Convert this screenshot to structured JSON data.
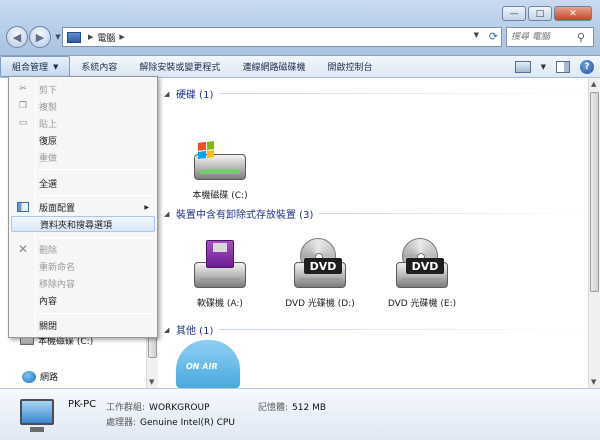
{
  "window": {
    "controls": [
      "—",
      "□",
      "✕"
    ]
  },
  "address": {
    "crumb": "電腦",
    "search_placeholder": "搜尋 電腦"
  },
  "toolbar": {
    "organize": "組合管理",
    "items": [
      "系統內容",
      "解除安裝或變更程式",
      "連線網路磁碟機",
      "開啟控制台"
    ]
  },
  "menu": {
    "cut": "剪下",
    "copy": "複製",
    "paste": "貼上",
    "undo": "復原",
    "redo": "重做",
    "select_all": "全選",
    "layout": "版面配置",
    "folder_options": "資料夾和搜尋選項",
    "delete": "刪除",
    "rename": "重新命名",
    "remove_properties": "移除內容",
    "properties": "內容",
    "close": "關閉"
  },
  "navpane": {
    "local_disk": "本機磁碟 (C:)",
    "network": "網路"
  },
  "content": {
    "groups": {
      "hdd": "硬碟 (1)",
      "removable": "裝置中含有卸除式存放裝置 (3)",
      "other": "其他 (1)"
    },
    "drives": {
      "c": "本機磁碟 (C:)",
      "a": "軟碟機 (A:)",
      "d": "DVD 光碟機 (D:)",
      "e": "DVD 光碟機 (E:)"
    },
    "dvd_badge": "DVD",
    "onair": "ON AIR"
  },
  "details": {
    "name": "PK-PC",
    "workgroup_key": "工作群組:",
    "workgroup_val": "WORKGROUP",
    "memory_key": "記憶體:",
    "memory_val": "512 MB",
    "cpu_key": "處理器:",
    "cpu_val": "Genuine Intel(R) CPU"
  }
}
